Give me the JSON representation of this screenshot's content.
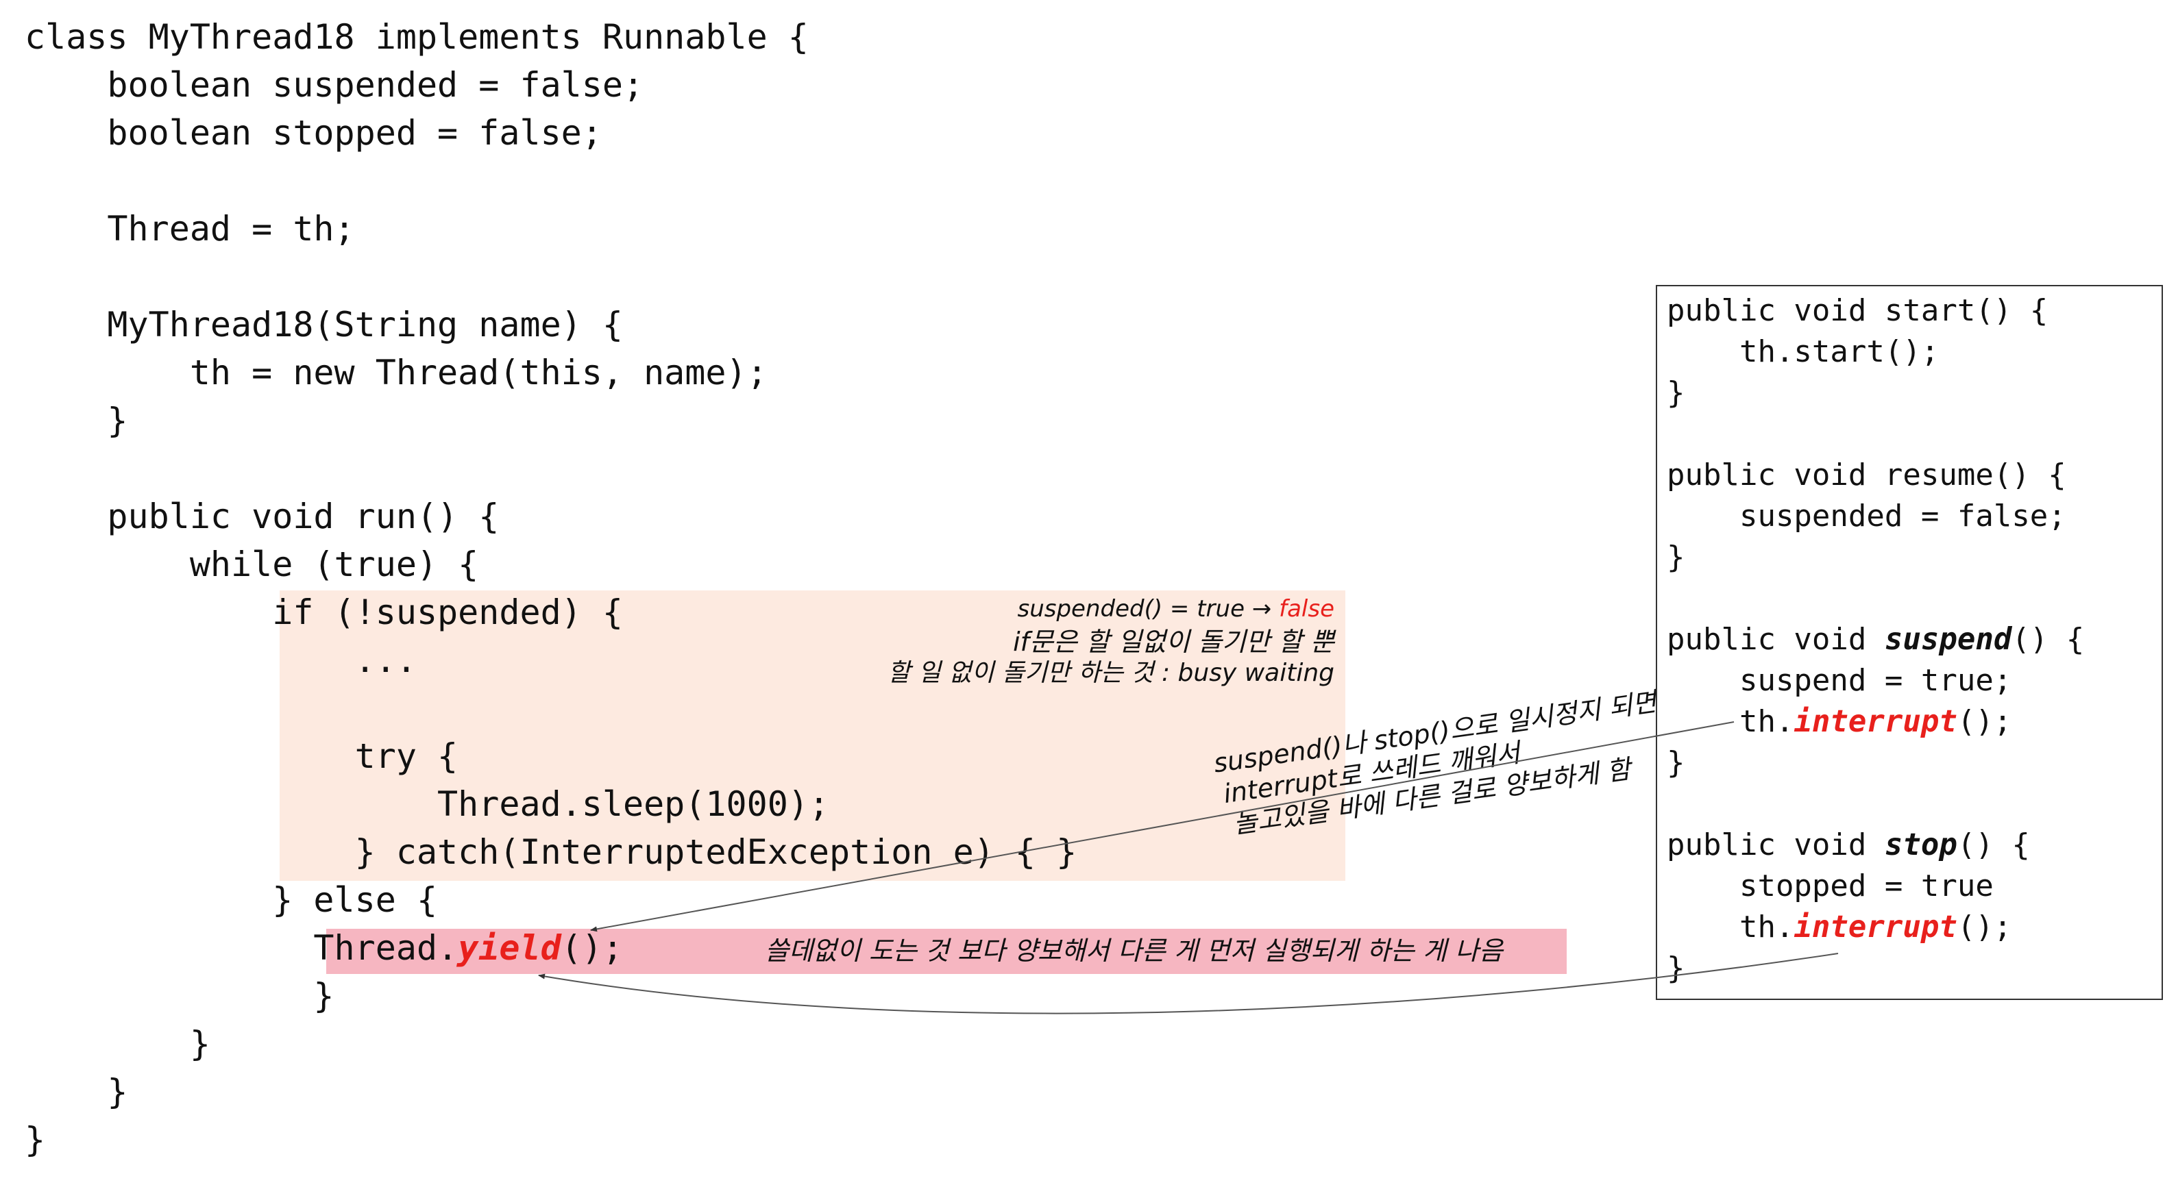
{
  "main_code": {
    "lines": [
      "class MyThread18 implements Runnable {",
      "    boolean suspended = false;",
      "    boolean stopped = false;",
      "    Thread = th;",
      "    MyThread18(String name) {",
      "        th = new Thread(this, name);",
      "    }",
      "    public void run() {",
      "        while (true) {",
      "            if (!suspended) {",
      "                ...",
      "                try {",
      "                    Thread.sleep(1000);",
      "                } catch(InterruptedException e) { }",
      "            } else {",
      "              Thread.",
      "yield",
      "();",
      "              }",
      "        }",
      "    }",
      "}"
    ]
  },
  "method_box": {
    "start_sig": "public void start() {",
    "start_body": "    th.start();",
    "start_close": "}",
    "resume_sig": "public void resume() {",
    "resume_body": "    suspended = false;",
    "resume_close": "}",
    "suspend_sig_pre": "public void ",
    "suspend_name": "suspend",
    "suspend_sig_post": "() {",
    "suspend_body1": "    suspend = true;",
    "suspend_body2_pre": "    th.",
    "interrupt_name": "interrupt",
    "suspend_body2_post": "();",
    "suspend_close": "}",
    "stop_sig_pre": "public void ",
    "stop_name": "stop",
    "stop_sig_post": "() {",
    "stop_body1": "    stopped = true",
    "stop_body2_pre": "    th.",
    "stop_body2_post": "();",
    "stop_close": "}"
  },
  "annotations": {
    "busy_line1_pre": "suspended() = true → ",
    "busy_line1_red": "false",
    "busy_line2": "if문은 할 일없이 돌기만 할 뿐",
    "busy_line3": "할 일 없이 돌기만 하는 것 : busy waiting",
    "interrupt_line1": "suspend()나 stop()으로 일시정지 되면",
    "interrupt_line2": "interrupt로 쓰레드 깨워서",
    "interrupt_line3": "놀고있을 바에 다른 걸로 양보하게 함",
    "yield_note": "쓸데없이 도는 것 보다 양보해서 다른 게 먼저 실행되게 하는 게 나음"
  },
  "colors": {
    "accent_red": "#e8201c",
    "peach_highlight": "#fdeae0",
    "pink_highlight": "#f6b6c1"
  }
}
